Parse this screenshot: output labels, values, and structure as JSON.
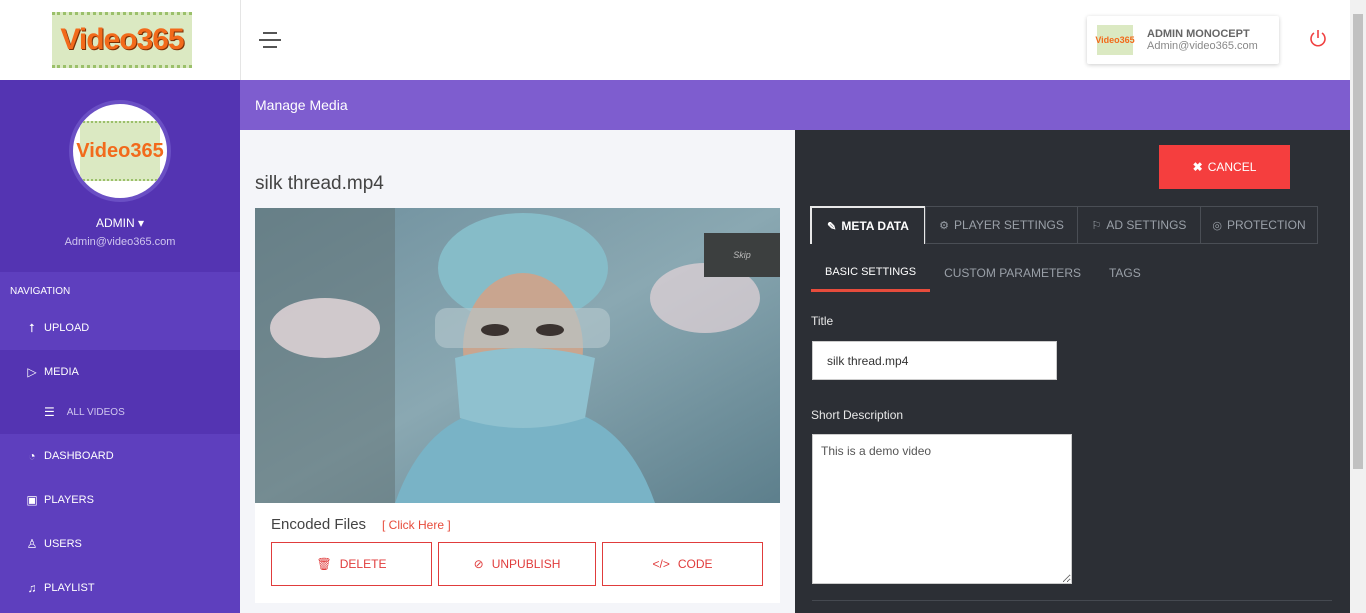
{
  "header": {
    "logo_text": "Video365",
    "user_name": "ADMIN MONOCEPT",
    "user_email": "Admin@video365.com"
  },
  "sidebar": {
    "avatar_text": "Video365",
    "admin_name": "ADMIN",
    "admin_email": "Admin@video365.com",
    "nav_heading": "NAVIGATION",
    "items": [
      {
        "label": "UPLOAD",
        "icon": "upload-icon"
      },
      {
        "label": "MEDIA",
        "icon": "play-icon"
      },
      {
        "label": "ALL VIDEOS",
        "icon": "list-icon"
      },
      {
        "label": "DASHBOARD",
        "icon": "gauge-icon"
      },
      {
        "label": "PLAYERS",
        "icon": "player-icon"
      },
      {
        "label": "USERS",
        "icon": "user-icon"
      },
      {
        "label": "PLAYLIST",
        "icon": "playlist-icon"
      }
    ]
  },
  "page": {
    "title": "Manage Media",
    "filename": "silk thread.mp4",
    "skip_label": "Skip",
    "encoded_label": "Encoded Files",
    "encoded_link": "[ Click Here ]",
    "buttons": {
      "delete": "DELETE",
      "unpublish": "UNPUBLISH",
      "code": "CODE"
    }
  },
  "editor": {
    "cancel": "CANCEL",
    "tabs": [
      "META DATA",
      "PLAYER SETTINGS",
      "AD SETTINGS",
      "PROTECTION"
    ],
    "subtabs": [
      "BASIC SETTINGS",
      "CUSTOM PARAMETERS",
      "TAGS"
    ],
    "title_label": "Title",
    "title_value": "silk thread.mp4",
    "desc_label": "Short Description",
    "desc_value": "This is a demo video"
  },
  "colors": {
    "sidebar": "#5e3fbe",
    "titlebar": "#7e5dcf",
    "accent_red": "#f53e3e",
    "dark_panel": "#2c2f35"
  }
}
